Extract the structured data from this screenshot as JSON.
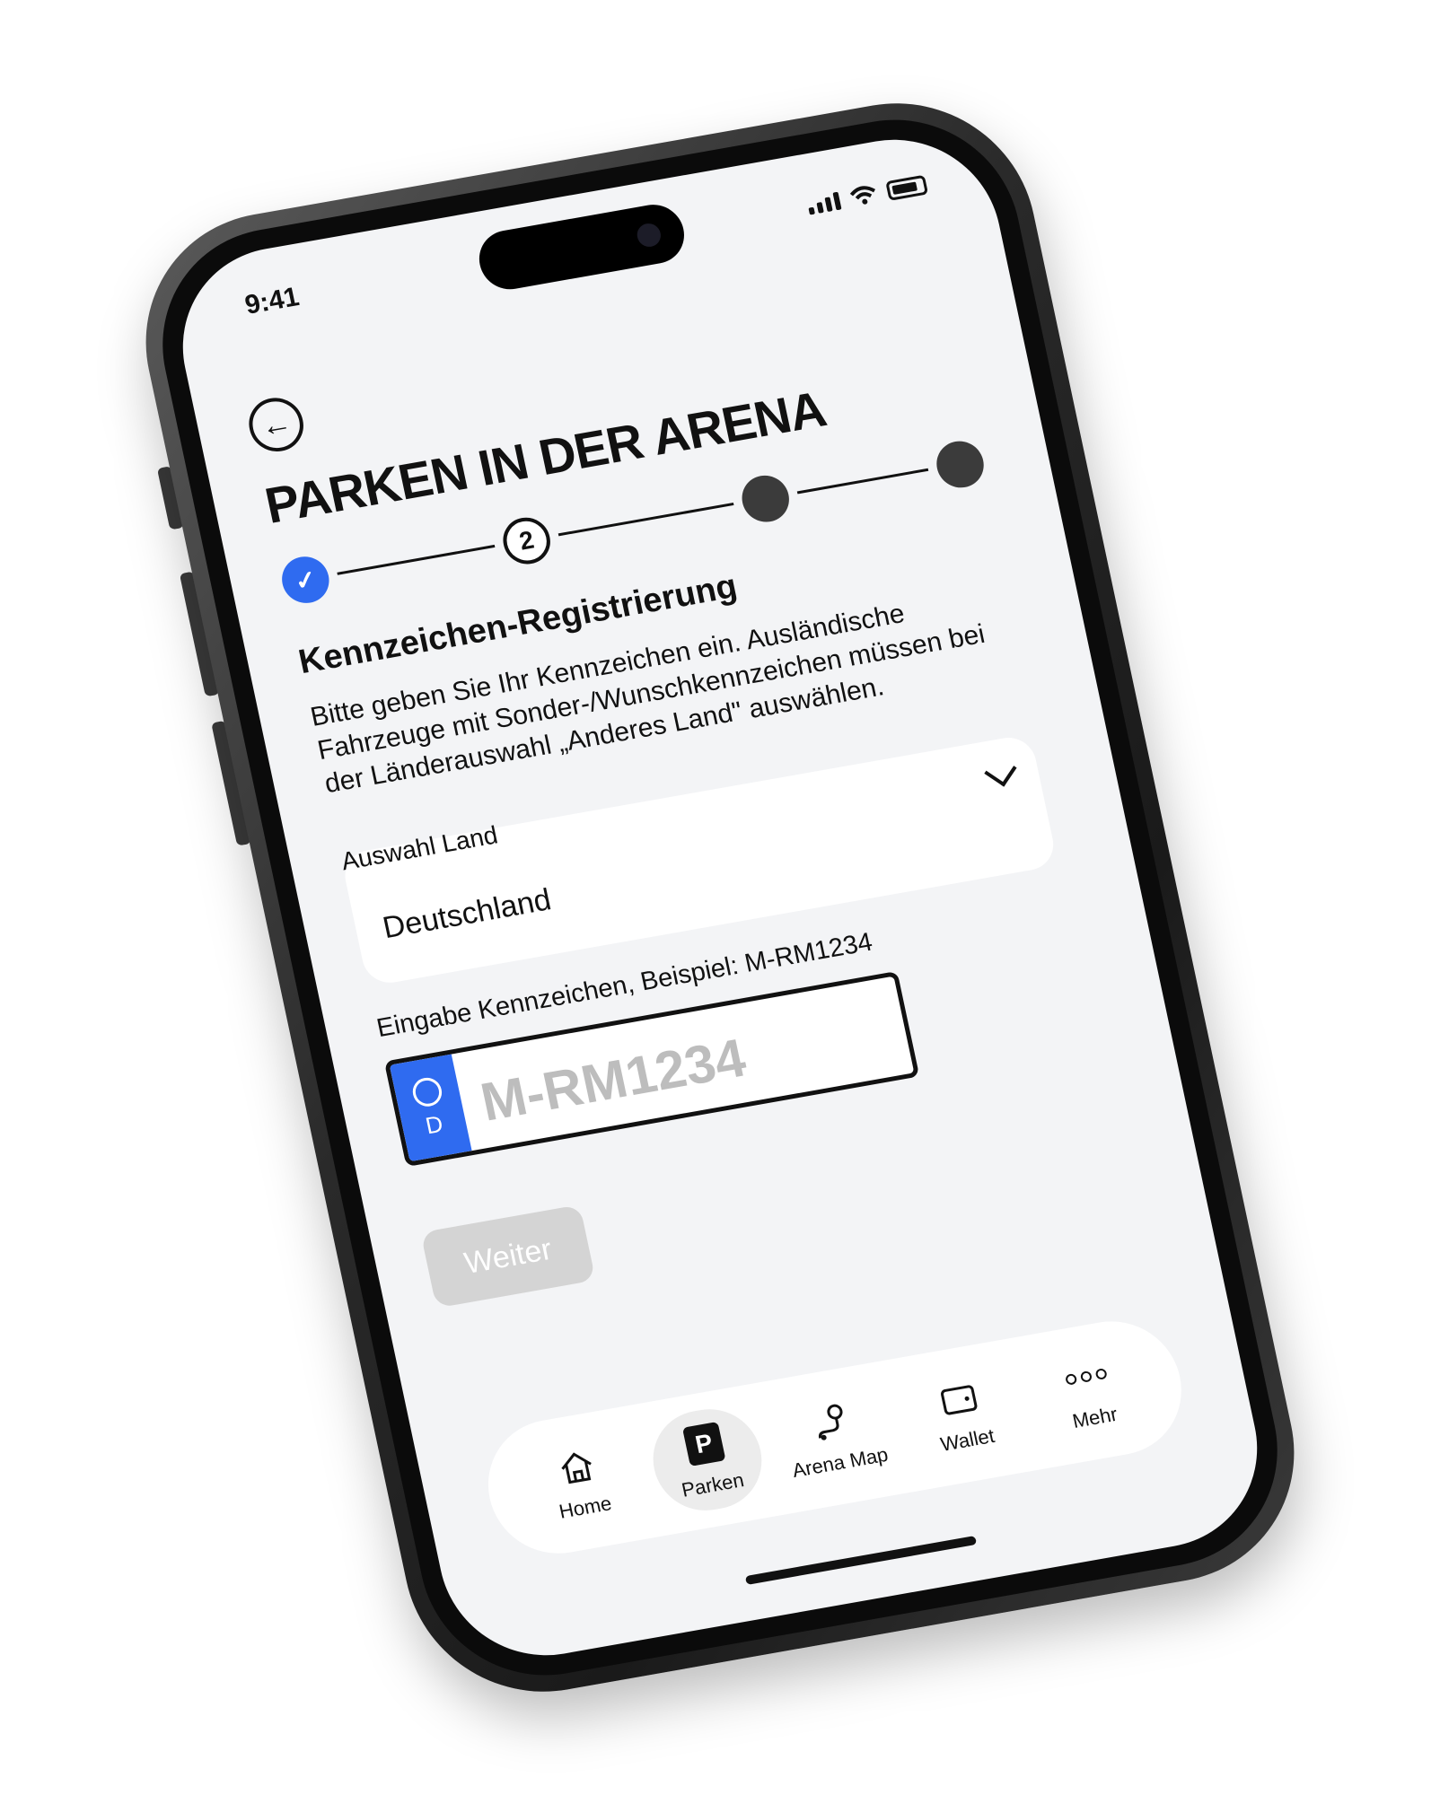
{
  "status": {
    "time": "9:41"
  },
  "header": {
    "title": "PARKEN IN DER ARENA",
    "back_icon": "arrow-left-icon"
  },
  "stepper": {
    "steps": [
      "✓",
      "2",
      "",
      ""
    ]
  },
  "section": {
    "title": "Kennzeichen-Registrierung",
    "description": "Bitte geben Sie Ihr Kennzeichen ein. Ausländische Fahrzeuge mit Sonder-/Wunschkennzeichen müssen bei der Länderauswahl „Anderes Land\" auswählen."
  },
  "country_select": {
    "label": "Auswahl Land",
    "value": "Deutschland"
  },
  "plate": {
    "label": "Eingabe Kennzeichen, Beispiel: M-RM1234",
    "country_code": "D",
    "value": "",
    "placeholder": "M-RM1234"
  },
  "actions": {
    "next_label": "Weiter"
  },
  "tabbar": {
    "items": [
      {
        "label": "Home",
        "icon": "home-icon"
      },
      {
        "label": "Parken",
        "icon": "parking-icon",
        "active": true
      },
      {
        "label": "Arena Map",
        "icon": "map-pin-icon"
      },
      {
        "label": "Wallet",
        "icon": "wallet-icon"
      },
      {
        "label": "Mehr",
        "icon": "more-icon"
      }
    ]
  },
  "colors": {
    "accent": "#2f6bf0",
    "disabled": "#d4d4d4",
    "background": "#f3f4f6"
  }
}
